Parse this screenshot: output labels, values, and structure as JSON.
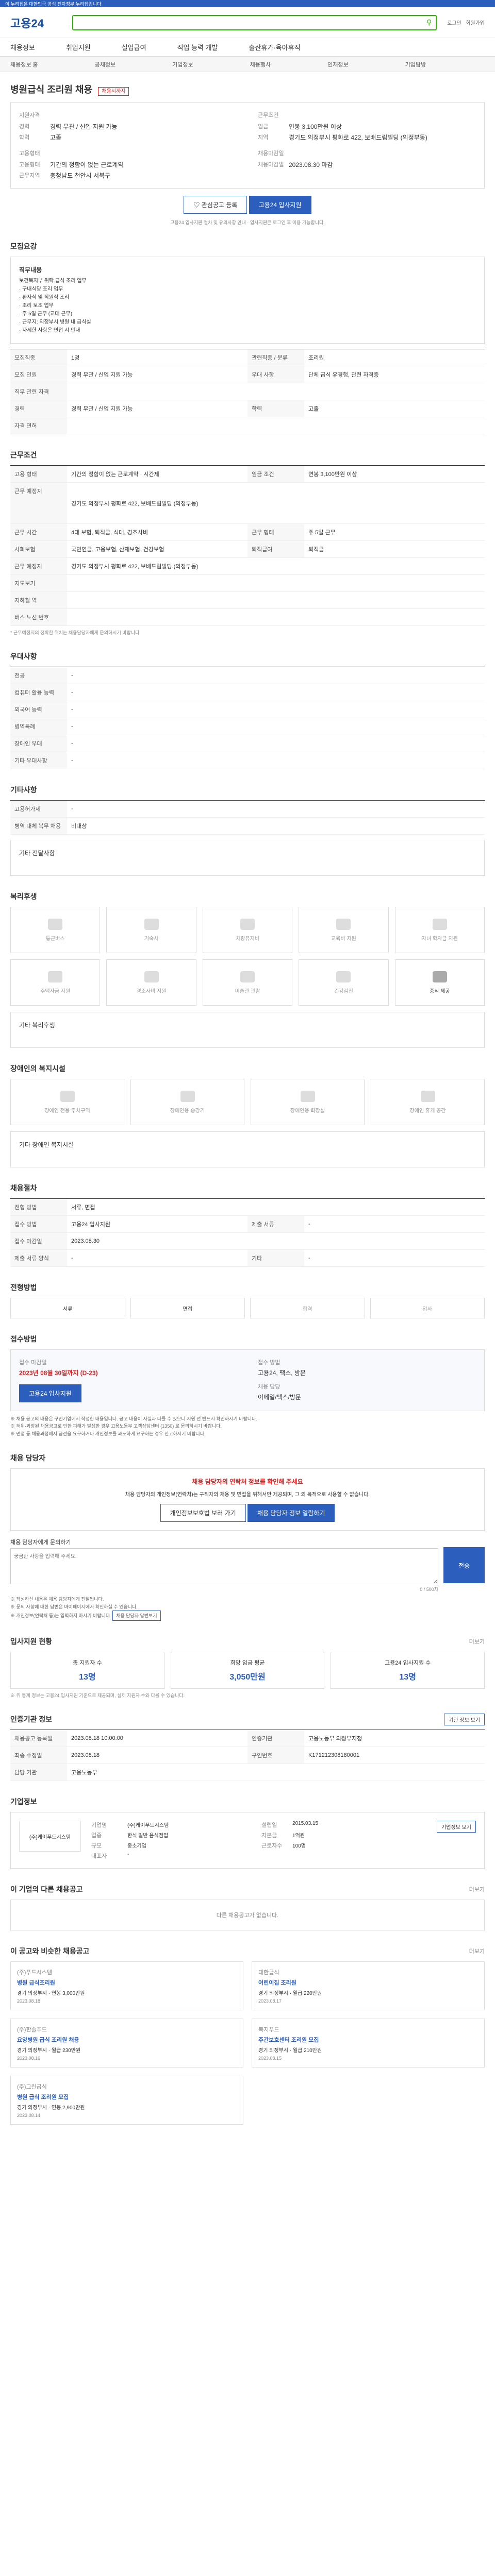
{
  "brand": {
    "logo": "고용24",
    "accent": "#2b5ebd",
    "search_border": "#2db400"
  },
  "topbar": {
    "notice": "이 누리집은 대한민국 공식 전자정부 누리집입니다"
  },
  "header": {
    "login": "로그인",
    "join": "회원가입"
  },
  "nav": {
    "items": [
      "채용정보",
      "취업지원",
      "실업급여",
      "직업 능력 개발",
      "출산휴가·육아휴직"
    ]
  },
  "subnav": {
    "items": [
      "채용정보 홈",
      "공채정보",
      "기업정보",
      "채용행사",
      "인재정보",
      "기업탐방"
    ]
  },
  "job": {
    "company": "병원급식 조리원 채용",
    "badge": "채용시까지",
    "title_sub": "(주)케이푸드시스템 외",
    "left": [
      {
        "label": "지원자격",
        "value": ""
      },
      {
        "label": "경력",
        "value": "경력 무관 / 신입 지원 가능"
      },
      {
        "label": "학력",
        "value": "고졸"
      },
      {
        "label": "고용형태",
        "value": ""
      },
      {
        "label": "고용형태",
        "value": "기간의 정함이 없는 근로계약"
      },
      {
        "label": "근무지역",
        "value": "충청남도 천안시 서북구"
      }
    ],
    "right": [
      {
        "label": "근무조건",
        "value": ""
      },
      {
        "label": "임금",
        "value": "연봉 3,100만원 이상"
      },
      {
        "label": "지역",
        "value": "경기도 의정부시 평화로 422, 보배드림빌딩 (의정부동)"
      },
      {
        "label": "채용마감일",
        "value": ""
      },
      {
        "label": "채용마감일",
        "value": "2023.08.30 마감"
      }
    ],
    "btn_save": "관심공고 등록",
    "btn_apply": "고용24 입사지원",
    "note": "고용24 입사지원 절차 및 유의사항 안내 · 입사지원은 로그인 후 이용 가능합니다."
  },
  "recruit": {
    "title": "모집요강",
    "job_desc_label": "직무내용",
    "job_desc": "보건복지부 위탁 급식 조리 업무\n· 구내식당 조리 업무\n· 환자식 및 직원식 조리\n· 조리 보조 업무\n· 주 5일 근무 (교대 근무)\n· 근무지: 의정부시 병원 내 급식실\n· 자세한 사항은 면접 시 안내",
    "rows": [
      {
        "label": "모집직종",
        "value": "1명",
        "label2": "관련직종 / 분류",
        "value2": "조리원"
      },
      {
        "label": "모집 인원",
        "value": "경력 무관 / 신입 지원 가능",
        "label2": "우대 사항",
        "value2": "단체 급식 유경험, 관련 자격증"
      },
      {
        "label": "직무 관련 자격",
        "value": "",
        "label2": "",
        "value2": ""
      },
      {
        "label": "경력",
        "value": "경력 무관 / 신입 지원 가능",
        "label2": "학력",
        "value2": "고졸"
      },
      {
        "label": "자격 면허",
        "value": "",
        "label2": "",
        "value2": ""
      }
    ]
  },
  "work": {
    "title": "근무조건",
    "rows": [
      {
        "label": "고용 형태",
        "value": "기간의 정함이 없는 근로계약 · 시간제",
        "label2": "임금 조건",
        "value2": "연봉 3,100만원 이상"
      },
      {
        "label": "근무 예정지",
        "value": "경기도 의정부시 평화로 422, 보배드림빌딩 (의정부동)",
        "label2": "",
        "value2": ""
      },
      {
        "label": "근무 시간",
        "value": "4대 보험, 퇴직금, 식대, 경조사비",
        "label2": "근무 형태",
        "value2": "주 5일 근무"
      },
      {
        "label": "사회보험",
        "value": "국민연금, 고용보험, 산재보험, 건강보험",
        "label2": "퇴직급여",
        "value2": "퇴직금"
      },
      {
        "label": "근무 예정지",
        "value": "경기도 의정부시 평화로 422, 보배드림빌딩 (의정부동)",
        "label2": "",
        "value2": ""
      },
      {
        "label": "지도보기",
        "value": "",
        "label2": "",
        "value2": ""
      },
      {
        "label": "지하철 역",
        "value": "",
        "label2": "",
        "value2": ""
      },
      {
        "label": "버스 노선 번호",
        "value": "",
        "label2": "",
        "value2": ""
      }
    ],
    "note": "* 근무예정지의 정확한 위치는 채용담당자에게 문의하시기 바랍니다."
  },
  "pref": {
    "title": "우대사항",
    "rows": [
      {
        "label": "전공",
        "value": "-"
      },
      {
        "label": "컴퓨터 활용 능력",
        "value": "-"
      },
      {
        "label": "외국어 능력",
        "value": "-"
      },
      {
        "label": "병역특례",
        "value": "-"
      },
      {
        "label": "장애인 우대",
        "value": "-"
      },
      {
        "label": "기타 우대사항",
        "value": "-"
      }
    ]
  },
  "extra": {
    "title": "기타사항",
    "rows": [
      {
        "label": "고용허가제",
        "value": "-"
      },
      {
        "label": "병역 대체 복무 채용",
        "value": "비대상"
      }
    ],
    "note": "기타 전달사항"
  },
  "welfare": {
    "title": "복리후생",
    "tiles": [
      "통근버스",
      "기숙사",
      "차량유지비",
      "교육비 지원",
      "자녀 학자금 지원",
      "주택자금 지원",
      "경조사비 지원",
      "미술관 관람",
      "건강검진",
      "중식 제공"
    ],
    "note_label": "기타 복리후생"
  },
  "disability": {
    "title": "장애인의 복지시설",
    "tiles": [
      "장애인 전용 주차구역",
      "장애인용 승강기",
      "장애인용 화장실",
      "장애인 휴게 공간"
    ],
    "note_label": "기타 장애인 복지시설"
  },
  "selection": {
    "title": "채용절차",
    "rows": [
      {
        "label": "전형 방법",
        "value": "서류, 면접",
        "label2": "",
        "value2": ""
      },
      {
        "label": "접수 방법",
        "value": "고용24 입사지원",
        "label2": "제출 서류",
        "value2": "-"
      },
      {
        "label": "접수 마감일",
        "value": "2023.08.30",
        "label2": "",
        "value2": ""
      },
      {
        "label": "제출 서류 양식",
        "value": "-",
        "label2": "기타",
        "value2": "-"
      }
    ]
  },
  "process": {
    "title": "전형방법",
    "steps": [
      "서류",
      "면접",
      "합격",
      "입사"
    ]
  },
  "apply": {
    "title": "접수방법",
    "deadline_label": "접수 마감일",
    "deadline": "2023년 08월 30일까지 (D-23)",
    "method_label": "접수 방법",
    "method": "고용24, 팩스, 방문",
    "contact_label": "채용 담당",
    "contact": "이메일/팩스/방문",
    "btn": "고용24 입사지원",
    "notes": [
      "※ 채용 공고의 내용은 구인기업에서 작성한 내용입니다. 공고 내용이 사실과 다를 수 있으니 지원 전 반드시 확인하시기 바랍니다.",
      "※ 허위·과장된 채용공고로 인한 피해가 발생한 경우 고용노동부 고객상담센터 (1350) 로 문의하시기 바랍니다.",
      "※ 면접 등 채용과정에서 금전을 요구하거나 개인정보를 과도하게 요구하는 경우 신고하시기 바랍니다."
    ]
  },
  "manager": {
    "title": "채용 담당자",
    "warn_title": "채용 담당자의 연락처 정보를 확인해 주세요",
    "warn_text": "채용 담당자의 개인정보(연락처)는 구직자의 채용 및 면접을 위해서만 제공되며, 그 외 목적으로 사용할 수 없습니다.",
    "btn1": "개인정보보호법 보러 가기",
    "btn2": "채용 담당자 정보 열람하기",
    "qna_label": "채용 담당자에게 문의하기",
    "qna_placeholder": "궁금한 사항을 입력해 주세요.",
    "qna_count": "0 / 500자",
    "qna_btn": "전송",
    "notes": [
      "※ 작성하신 내용은 채용 담당자에게 전달됩니다.",
      "※ 문의 사항에 대한 답변은 마이페이지에서 확인하실 수 있습니다.",
      "※ 개인정보(연락처 등)는 입력하지 마시기 바랍니다."
    ],
    "notes_btn": "채용 담당자 답변보기"
  },
  "stats": {
    "title": "입사지원 현황",
    "more": "더보기",
    "cards": [
      {
        "label": "총 지원자 수",
        "value": "13명"
      },
      {
        "label": "희망 임금 평균",
        "value": "3,050만원"
      },
      {
        "label": "고용24 입사지원 수",
        "value": "13명"
      }
    ],
    "note": "※ 위 통계 정보는 고용24 입사지원 기준으로 제공되며, 실제 지원자 수와 다를 수 있습니다."
  },
  "org": {
    "title": "인증기관 정보",
    "btn": "기관 정보 보기",
    "rows": [
      {
        "label": "채용공고 등록일",
        "value": "2023.08.18 10:00:00",
        "label2": "인증기관",
        "value2": "고용노동부 의정부지청"
      },
      {
        "label": "최종 수정일",
        "value": "2023.08.18",
        "label2": "구인번호",
        "value2": "K171212308180001"
      },
      {
        "label": "담당 기관",
        "value": "고용노동부",
        "label2": "",
        "value2": ""
      }
    ]
  },
  "company": {
    "title": "기업정보",
    "name": "(주)케이푸드시스템",
    "rows": [
      {
        "label": "기업명",
        "value": "(주)케이푸드시스템",
        "label2": "설립일",
        "value2": "2015.03.15"
      },
      {
        "label": "업종",
        "value": "한식 일반 음식점업",
        "label2": "자본금",
        "value2": "1억원"
      },
      {
        "label": "규모",
        "value": "중소기업",
        "label2": "근로자수",
        "value2": "100명"
      },
      {
        "label": "대표자",
        "value": "-",
        "label2": "",
        "value2": ""
      }
    ],
    "btn": "기업정보 보기"
  },
  "same_company": {
    "title": "이 기업의 다른 채용공고",
    "more": "더보기",
    "empty": "다른 채용공고가 없습니다."
  },
  "recommend": {
    "title": "이 공고와 비슷한 채용공고",
    "more": "더보기",
    "items": [
      {
        "company": "(주)푸드시스템",
        "title": "병원 급식조리원",
        "loc": "경기 의정부시",
        "wage": "연봉 3,000만원",
        "date": "2023.08.18"
      },
      {
        "company": "대한급식",
        "title": "어린이집 조리원",
        "loc": "경기 의정부시",
        "wage": "월급 220만원",
        "date": "2023.08.17"
      },
      {
        "company": "(주)한솔푸드",
        "title": "요양병원 급식 조리원 채용",
        "loc": "경기 의정부시",
        "wage": "월급 230만원",
        "date": "2023.08.16"
      },
      {
        "company": "복지푸드",
        "title": "주간보호센터 조리원 모집",
        "loc": "경기 의정부시",
        "wage": "월급 210만원",
        "date": "2023.08.15"
      },
      {
        "company": "(주)그린급식",
        "title": "병원 급식 조리원 모집",
        "loc": "경기 의정부시",
        "wage": "연봉 2,900만원",
        "date": "2023.08.14"
      }
    ]
  }
}
